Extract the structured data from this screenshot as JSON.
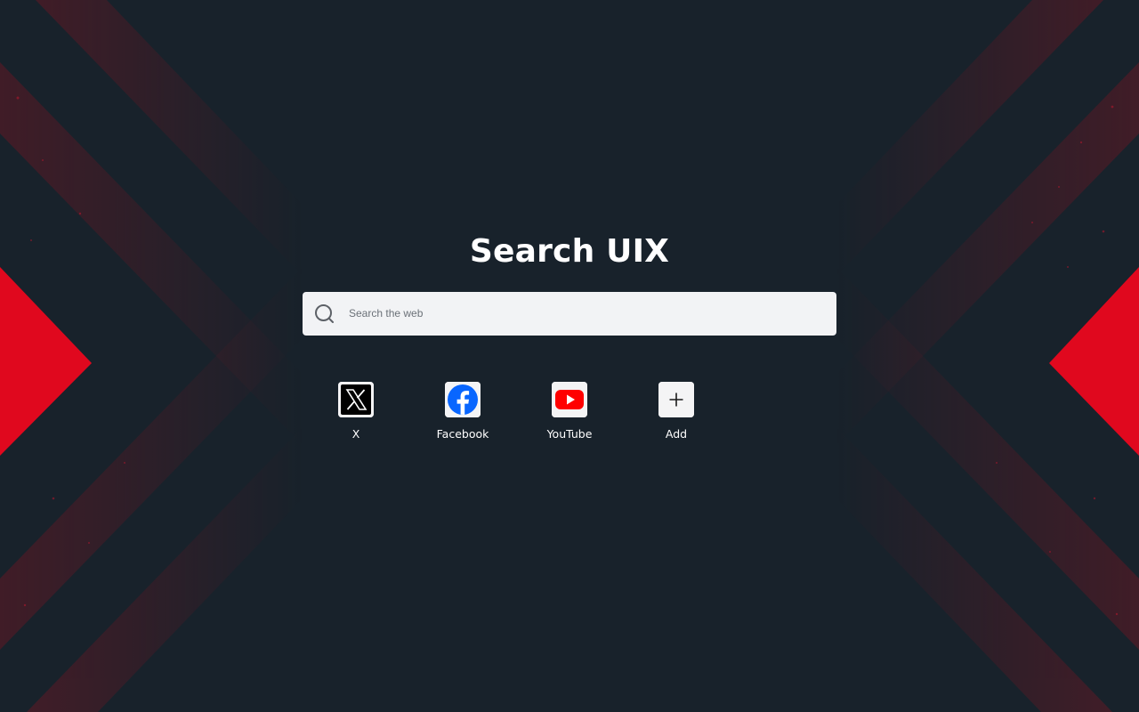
{
  "page": {
    "title": "Search UIX"
  },
  "search": {
    "placeholder": "Search the web",
    "icon": "search-icon"
  },
  "shortcuts": [
    {
      "label": "X",
      "icon": "x-logo-icon",
      "color": "#000000"
    },
    {
      "label": "Facebook",
      "icon": "facebook-logo-icon",
      "color": "#0866ff"
    },
    {
      "label": "YouTube",
      "icon": "youtube-logo-icon",
      "color": "#ff0000"
    },
    {
      "label": "Add",
      "icon": "plus-icon",
      "color": "#1a1a1a"
    }
  ],
  "theme": {
    "background": "#18222b",
    "accent": "#e0081e",
    "search_bg": "#f2f3f5",
    "text": "#ffffff"
  }
}
